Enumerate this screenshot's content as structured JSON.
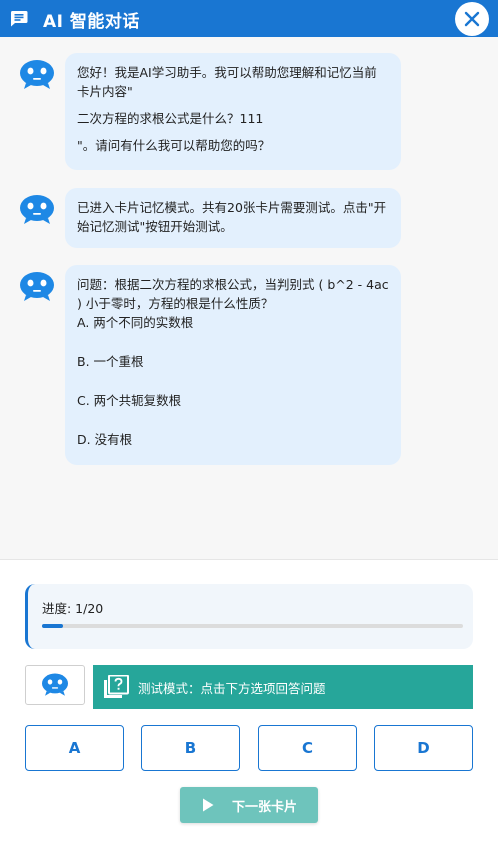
{
  "header": {
    "title": "AI 智能对话",
    "icons": {
      "chat": "chat-icon",
      "close": "close-icon"
    }
  },
  "messages": [
    {
      "lines": [
        "您好！我是AI学习助手。我可以帮助您理解和记忆当前卡片内容\"",
        "二次方程的求根公式是什么？111",
        "\"。请问有什么我可以帮助您的吗？"
      ]
    },
    {
      "lines": [
        "已进入卡片记忆模式。共有20张卡片需要测试。点击\"开始记忆测试\"按钮开始测试。"
      ]
    },
    {
      "lines": [
        "问题：根据二次方程的求根公式，当判别式 ( b^2 - 4ac ) 小于零时，方程的根是什么性质？",
        "A. 两个不同的实数根",
        "B. 一个重根",
        "C. 两个共轭复数根",
        "D. 没有根"
      ]
    }
  ],
  "progress": {
    "label": "进度: 1/20",
    "fraction": 0.05
  },
  "mode_banner": {
    "text": "测试模式：点击下方选项回答问题",
    "icon": "quiz-icon"
  },
  "options": [
    "A",
    "B",
    "C",
    "D"
  ],
  "next_button": {
    "label": "下一张卡片",
    "icon": "play-icon"
  },
  "colors": {
    "primary": "#1976d2",
    "bubble": "#e3f0fd",
    "teal": "#26a69a",
    "teal_light": "#6ec4bc"
  }
}
